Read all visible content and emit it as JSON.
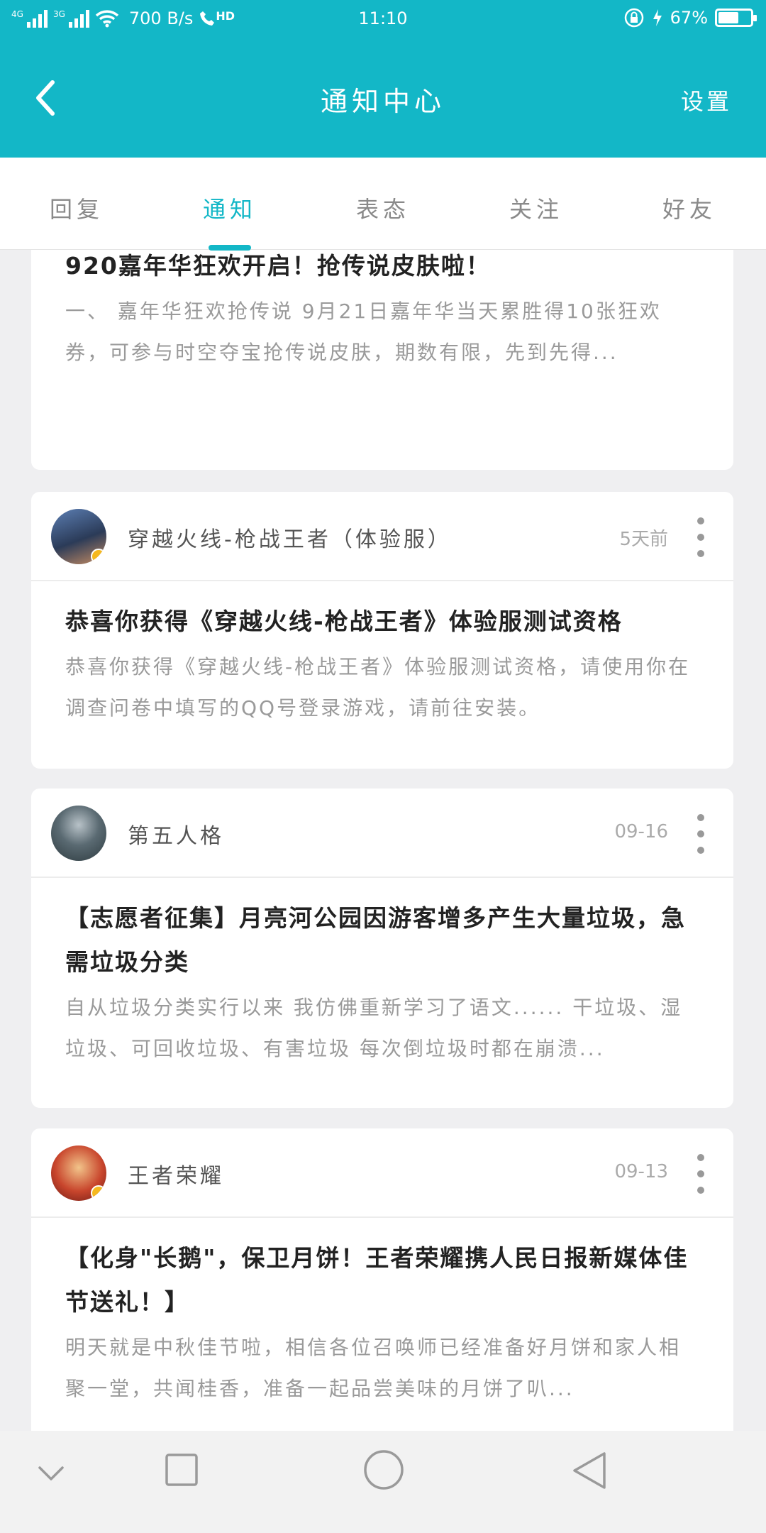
{
  "status": {
    "network": "4G",
    "network2": "3G",
    "speed": "700 B/s",
    "call_badge": "HD",
    "time": "11:10",
    "battery": "67%",
    "battery_level": 0.67
  },
  "header": {
    "title": "通知中心",
    "settings": "设置"
  },
  "tabs": [
    {
      "label": "回复",
      "active": false
    },
    {
      "label": "通知",
      "active": true
    },
    {
      "label": "表态",
      "active": false
    },
    {
      "label": "关注",
      "active": false
    },
    {
      "label": "好友",
      "active": false
    }
  ],
  "cards": [
    {
      "name": "",
      "time": "",
      "title": "920嘉年华狂欢开启！抢传说皮肤啦！",
      "excerpt": "一、    嘉年华狂欢抢传说 9月21日嘉年华当天累胜得10张狂欢券，可参与时空夺宝抢传说皮肤，期数有限，先到先得..."
    },
    {
      "name": "穿越火线-枪战王者（体验服）",
      "time": "5天前",
      "title": "恭喜你获得《穿越火线-枪战王者》体验服测试资格",
      "excerpt": "恭喜你获得《穿越火线-枪战王者》体验服测试资格，请使用你在调查问卷中填写的QQ号登录游戏，请前往安装。"
    },
    {
      "name": "第五人格",
      "time": "09-16",
      "title": "【志愿者征集】月亮河公园因游客增多产生大量垃圾，急需垃圾分类",
      "excerpt": "自从垃圾分类实行以来 我仿佛重新学习了语文...... 干垃圾、湿垃圾、可回收垃圾、有害垃圾 每次倒垃圾时都在崩溃..."
    },
    {
      "name": "王者荣耀",
      "time": "09-13",
      "title": "【化身\"长鹅\"，保卫月饼！王者荣耀携人民日报新媒体佳节送礼！】",
      "excerpt": "明天就是中秋佳节啦，相信各位召唤师已经准备好月饼和家人相聚一堂，共闻桂香，准备一起品尝美味的月饼了叭..."
    }
  ],
  "colors": {
    "accent": "#13b7c7",
    "background": "#efeff1"
  }
}
